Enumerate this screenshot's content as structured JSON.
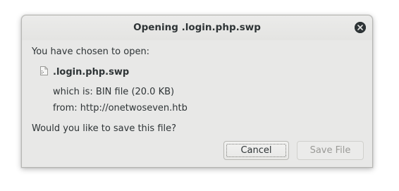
{
  "dialog": {
    "title": "Opening .login.php.swp",
    "prompt": "You have chosen to open:",
    "file": {
      "name": ".login.php.swp",
      "which_is": "which is:  BIN file (20.0 KB)",
      "from": "from:  http://onetwoseven.htb",
      "icon": "file-icon"
    },
    "question": "Would you like to save this file?",
    "buttons": {
      "cancel": "Cancel",
      "save": "Save File"
    },
    "close_icon": "close-icon"
  }
}
